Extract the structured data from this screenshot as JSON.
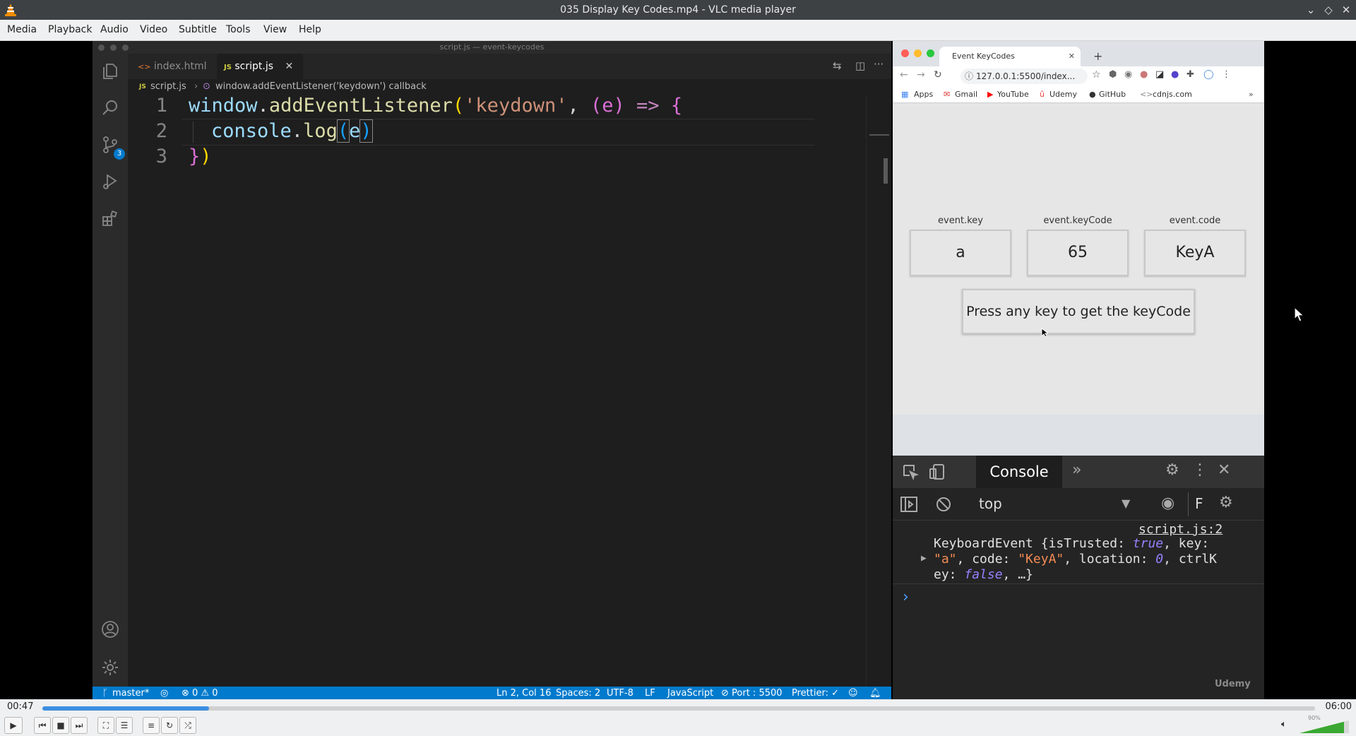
{
  "vlc": {
    "title": "035 Display Key Codes.mp4 - VLC media player",
    "menu": [
      "Media",
      "Playback",
      "Audio",
      "Video",
      "Subtitle",
      "Tools",
      "View",
      "Help"
    ],
    "time_current": "00:47",
    "time_total": "06:00",
    "progress": 0.131,
    "volume_label": "90%",
    "volume": 0.9
  },
  "vscode": {
    "window_title": "script.js — event-keycodes",
    "tabs": [
      {
        "label": "index.html",
        "icon": "html-icon",
        "active": false
      },
      {
        "label": "script.js",
        "icon": "js-icon",
        "active": true
      }
    ],
    "breadcrumb": {
      "file": "script.js",
      "symbol": "window.addEventListener('keydown') callback"
    },
    "scm_badge": "3",
    "line_numbers": [
      "1",
      "2",
      "3"
    ],
    "code": {
      "l1_obj": "window",
      "l1_dot": ".",
      "l1_fn": "addEventListener",
      "l1_open": "(",
      "l1_str": "'keydown'",
      "l1_comma": ", ",
      "l1_params": "(e)",
      "l1_arrow": " => ",
      "l1_brace": "{",
      "l2_obj": "console",
      "l2_dot": ".",
      "l2_fn": "log",
      "l2_open": "(",
      "l2_arg": "e",
      "l2_close": ")",
      "l3_brace": "}",
      "l3_paren": ")"
    },
    "status": {
      "branch": "master*",
      "problems": "⊗ 0 ⚠ 0",
      "position": "Ln 2, Col 16",
      "spaces": "Spaces: 2",
      "encoding": "UTF-8",
      "eol": "LF",
      "language": "JavaScript",
      "port": "⊘ Port : 5500",
      "prettier": "Prettier: ✓"
    }
  },
  "browser": {
    "tab_title": "Event KeyCodes",
    "url": "127.0.0.1:5500/index...",
    "bookmarks": [
      "Apps",
      "Gmail",
      "YouTube",
      "Udemy",
      "GitHub",
      "cdnjs.com"
    ],
    "labels": [
      "event.key",
      "event.keyCode",
      "event.code"
    ],
    "values": [
      "a",
      "65",
      "KeyA"
    ],
    "prompt": "Press any key to get the keyCode",
    "devtools": {
      "tab": "Console",
      "context": "top",
      "source": "script.js:2",
      "log_l1a": "KeyboardEvent {isTrusted: ",
      "log_l1b": "true",
      "log_l1c": ", key:",
      "log_l2a": "\"a\"",
      "log_l2b": ", code: ",
      "log_l2c": "\"KeyA\"",
      "log_l2d": ", location: ",
      "log_l2e": "0",
      "log_l2f": ", ctrlK",
      "log_l3a": "ey: ",
      "log_l3b": "false",
      "log_l3c": ", …}",
      "prompt": "›"
    },
    "watermark": "Udemy"
  }
}
